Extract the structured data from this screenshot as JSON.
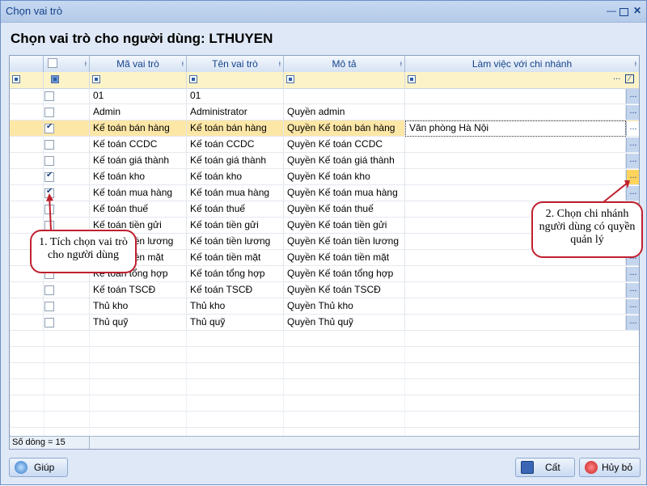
{
  "window": {
    "title": "Chọn vai trò"
  },
  "heading": "Chọn vai trò cho người dùng: LTHUYEN",
  "columns": [
    "Mã vai trò",
    "Tên vai trò",
    "Mô tả",
    "Làm việc với chi nhánh"
  ],
  "rows": [
    {
      "checked": false,
      "code": "01",
      "name": "01",
      "desc": "",
      "branch": ""
    },
    {
      "checked": false,
      "code": "Admin",
      "name": "Administrator",
      "desc": "Quyền admin",
      "branch": ""
    },
    {
      "checked": true,
      "code": "Kế toán bán hàng",
      "name": "Kế toán bán hàng",
      "desc": "Quyền Kế toán bán hàng",
      "branch": "Văn phòng Hà Nội",
      "selected": true
    },
    {
      "checked": false,
      "code": "Kế toán CCDC",
      "name": "Kế toán CCDC",
      "desc": "Quyền Kế toán CCDC",
      "branch": ""
    },
    {
      "checked": false,
      "code": "Kế toán giá thành",
      "name": "Kế toán giá thành",
      "desc": "Quyền Kế toán giá thành",
      "branch": ""
    },
    {
      "checked": true,
      "code": "Kế toán kho",
      "name": "Kế toán kho",
      "desc": "Quyền Kế toán kho",
      "branch": "",
      "hot": true
    },
    {
      "checked": true,
      "code": "Kế toán mua hàng",
      "name": "Kế toán mua hàng",
      "desc": "Quyền Kế toán mua hàng",
      "branch": ""
    },
    {
      "checked": false,
      "code": "Kế toán thuế",
      "name": "Kế toán thuế",
      "desc": "Quyền Kế toán thuế",
      "branch": ""
    },
    {
      "checked": false,
      "code": "Kế toán tiền gửi",
      "name": "Kế toán tiền gửi",
      "desc": "Quyền Kế toán tiền gửi",
      "branch": ""
    },
    {
      "checked": false,
      "code": "Kế toán tiền lương",
      "name": "Kế toán tiền lương",
      "desc": "Quyền Kế toán tiền lương",
      "branch": ""
    },
    {
      "checked": false,
      "code": "Kế toán tiền mặt",
      "name": "Kế toán tiền mặt",
      "desc": "Quyền Kế toán tiền mặt",
      "branch": ""
    },
    {
      "checked": false,
      "code": "Kế toán tổng hợp",
      "name": "Kế toán tổng hợp",
      "desc": "Quyền Kế toán tổng hợp",
      "branch": ""
    },
    {
      "checked": false,
      "code": "Kế toán TSCĐ",
      "name": "Kế toán TSCĐ",
      "desc": "Quyền Kế toán TSCĐ",
      "branch": ""
    },
    {
      "checked": false,
      "code": "Thủ kho",
      "name": "Thủ kho",
      "desc": "Quyền Thủ kho",
      "branch": ""
    },
    {
      "checked": false,
      "code": "Thủ quỹ",
      "name": "Thủ quỹ",
      "desc": "Quyền Thủ quỹ",
      "branch": ""
    }
  ],
  "row_count": "Số dòng = 15",
  "callouts": {
    "left": "1. Tích chọn vai trò cho người dùng",
    "right": "2. Chọn chi nhánh người dùng có quyền quản lý"
  },
  "buttons": {
    "help": "Giúp",
    "save": "Cất",
    "cancel": "Hủy bỏ"
  },
  "ellipsis": "..."
}
